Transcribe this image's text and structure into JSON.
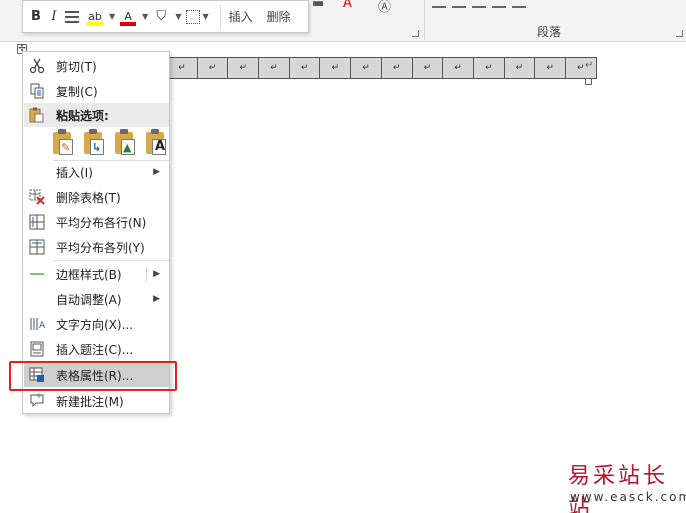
{
  "ribbon": {
    "paragraph_group": "段落",
    "mini_toolbar": {
      "bold": "B",
      "italic": "I",
      "highlight_glyph": "ab",
      "font_color_glyph": "A",
      "insert_label": "插入",
      "delete_label": "删除",
      "highlight_color": "#ffff00",
      "font_color": "#e00000"
    }
  },
  "table": {
    "cell_mark": "↵",
    "row_end_mark": "↵",
    "move_handle_glyph": "✢"
  },
  "context_menu": {
    "items": [
      {
        "label": "剪切(T)",
        "icon": "scissors-icon"
      },
      {
        "label": "复制(C)",
        "icon": "copy-icon"
      },
      {
        "label": "粘贴选项:",
        "icon": "paste-icon"
      },
      {
        "label": "插入(I)",
        "icon": "",
        "submenu": true
      },
      {
        "label": "删除表格(T)",
        "icon": "delete-table-icon"
      },
      {
        "label": "平均分布各行(N)",
        "icon": "distribute-rows-icon"
      },
      {
        "label": "平均分布各列(Y)",
        "icon": "distribute-columns-icon"
      },
      {
        "label": "边框样式(B)",
        "icon": "border-style-icon",
        "submenu": true
      },
      {
        "label": "自动调整(A)",
        "icon": "",
        "submenu": true
      },
      {
        "label": "文字方向(X)...",
        "icon": "text-direction-icon"
      },
      {
        "label": "插入题注(C)...",
        "icon": "insert-caption-icon"
      },
      {
        "label": "表格属性(R)...",
        "icon": "table-properties-icon",
        "selected": true
      },
      {
        "label": "新建批注(M)",
        "icon": "new-comment-icon"
      }
    ],
    "paste_options": [
      "keep-source-formatting-icon",
      "merge-formatting-icon",
      "picture-icon",
      "keep-text-only-icon"
    ],
    "highlight_color": "#e8221b"
  },
  "watermark": {
    "text": "易采站长站",
    "url": "www.easck.com"
  }
}
